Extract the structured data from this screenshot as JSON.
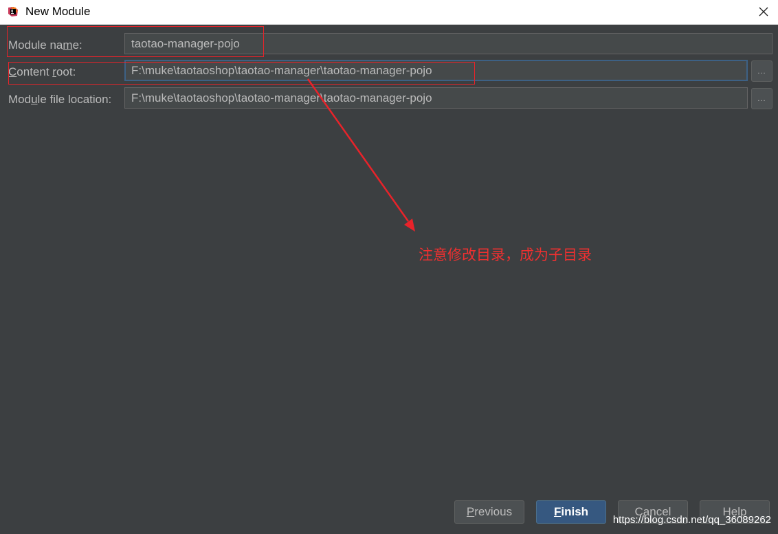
{
  "window": {
    "title": "New Module",
    "icon": "intellij-logo-icon",
    "close_icon": "close-icon"
  },
  "form": {
    "module_name": {
      "label_pre": "Module na",
      "label_mn": "m",
      "label_post": "e:",
      "value": "taotao-manager-pojo"
    },
    "content_root": {
      "label_mn": "C",
      "label_pre": "ontent ",
      "label_mn2": "r",
      "label_post": "oot:",
      "value": "F:\\muke\\taotaoshop\\taotao-manager\\taotao-manager-pojo",
      "browse_label": "..."
    },
    "module_file_location": {
      "label_pre": "Mod",
      "label_mn": "u",
      "label_post": "le file location:",
      "value": "F:\\muke\\taotaoshop\\taotao-manager\\taotao-manager-pojo",
      "browse_label": "..."
    }
  },
  "annotation": {
    "text": "注意修改目录，成为子目录",
    "color": "#ef3030"
  },
  "buttons": {
    "previous": {
      "mn": "P",
      "rest": "revious"
    },
    "finish": {
      "mn": "F",
      "rest": "inish"
    },
    "cancel": {
      "label": "Cancel"
    },
    "help": {
      "label": "Help"
    }
  },
  "watermark": "https://blog.csdn.net/qq_36089262",
  "colors": {
    "background": "#3c3f41",
    "field_bg": "#45494a",
    "text": "#bbbbbb",
    "primary_button": "#365880",
    "highlight": "#e8232a"
  }
}
